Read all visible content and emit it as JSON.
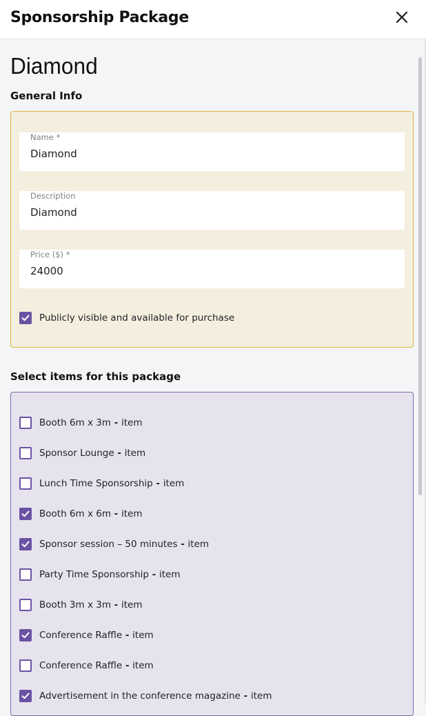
{
  "header": {
    "title": "Sponsorship Package",
    "close_icon": "close-icon"
  },
  "page": {
    "title": "Diamond"
  },
  "general_info": {
    "section_title": "General Info",
    "fields": {
      "name": {
        "label": "Name *",
        "value": "Diamond"
      },
      "description": {
        "label": "Description",
        "value": "Diamond"
      },
      "price": {
        "label": "Price ($) *",
        "value": "24000"
      }
    },
    "public_checkbox": {
      "label": "Publicly visible and available for purchase",
      "checked": true
    }
  },
  "items_section": {
    "title": "Select items for this package",
    "suffix_separator": " - ",
    "suffix": "item",
    "items": [
      {
        "name": "Booth 6m x 3m",
        "checked": false
      },
      {
        "name": "Sponsor Lounge",
        "checked": false
      },
      {
        "name": "Lunch Time Sponsorship",
        "checked": false
      },
      {
        "name": "Booth 6m x 6m",
        "checked": true
      },
      {
        "name": "Sponsor session – 50 minutes",
        "checked": true
      },
      {
        "name": "Party Time Sponsorship",
        "checked": false
      },
      {
        "name": "Booth 3m x 3m",
        "checked": false
      },
      {
        "name": "Conference Raffle",
        "checked": true
      },
      {
        "name": "Conference Raffle",
        "checked": false
      },
      {
        "name": "Advertisement in the conference magazine",
        "checked": true
      }
    ]
  },
  "colors": {
    "accent": "#6a52a3",
    "general_box_bg": "#f4eedf",
    "general_box_border": "#dcb440",
    "items_box_bg": "#e7e3ee",
    "items_box_border": "#7a68ad"
  }
}
